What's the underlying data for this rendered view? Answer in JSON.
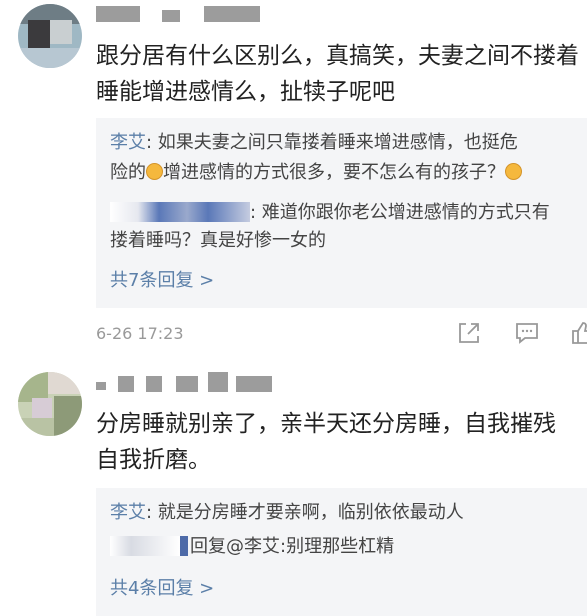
{
  "comments": [
    {
      "text_lines": [
        "跟分居有什么区别么，真搞笑，夫妻之间不搂着",
        "睡能增进感情么，扯犊子呢吧"
      ],
      "replies": [
        {
          "user": "李艾",
          "text_line1": ": 如果夫妻之间只靠搂着睡来增进感情，也挺危",
          "text_line2_pre": "险的",
          "emoji": "laughing-emoji",
          "text_line2_post": "增进感情的方式很多，要不怎么有的孩子？"
        },
        {
          "text_line1": ": 难道你跟你老公增进感情的方式只有",
          "text_line2": "搂着睡吗？真是好惨一女的"
        }
      ],
      "more_replies": "共7条回复 >",
      "timestamp": "6-26 17:23"
    },
    {
      "text_lines": [
        "分房睡就别亲了，亲半天还分房睡，自我摧残",
        "自我折磨。"
      ],
      "replies": [
        {
          "user": "李艾",
          "text": ": 就是分房睡才要亲啊，临别依依最动人"
        },
        {
          "text": "回复@李艾:别理那些杠精"
        }
      ],
      "more_replies": "共4条回复 >"
    }
  ],
  "icons": [
    "share-icon",
    "comment-icon",
    "like-icon"
  ]
}
